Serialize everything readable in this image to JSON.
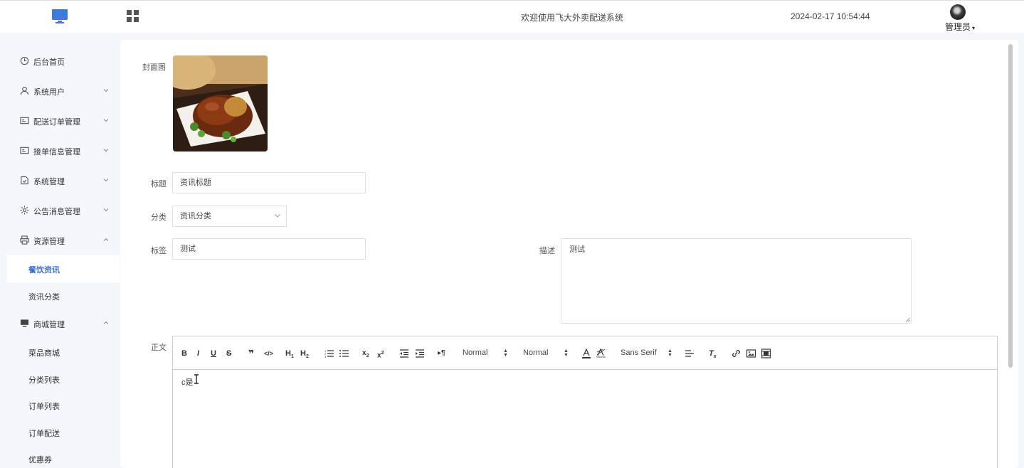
{
  "header": {
    "welcome": "欢迎使用飞大外卖配送系统",
    "datetime": "2024-02-17 10:54:44",
    "user_name": "管理员",
    "logo_icon": "monitor-icon",
    "apps_icon": "grid-icon"
  },
  "sidebar": {
    "items": [
      {
        "label": "后台首页",
        "icon": "clock-icon"
      },
      {
        "label": "系统用户",
        "icon": "user-icon"
      },
      {
        "label": "配送订单管理",
        "icon": "card-icon"
      },
      {
        "label": "接单信息管理",
        "icon": "card-icon"
      },
      {
        "label": "系统管理",
        "icon": "doc-check-icon"
      },
      {
        "label": "公告消息管理",
        "icon": "sun-icon"
      },
      {
        "label": "资源管理",
        "icon": "printer-icon"
      }
    ],
    "resource_sub": [
      "餐饮资讯",
      "资讯分类"
    ],
    "mall": {
      "label": "商城管理",
      "icon": "monitor-icon"
    },
    "mall_sub": [
      "菜品商城",
      "分类列表",
      "订单列表",
      "订单配送",
      "优惠券"
    ]
  },
  "form": {
    "cover_label": "封面图",
    "title_label": "标题",
    "title_value": "资讯标题",
    "category_label": "分类",
    "category_value": "资讯分类",
    "tag_label": "标签",
    "tag_value": "测试",
    "desc_label": "描述",
    "desc_value": "测试",
    "body_label": "正文"
  },
  "editor": {
    "header_select": "Normal",
    "size_select": "Normal",
    "font_select": "Sans Serif",
    "content": "c是"
  },
  "colors": {
    "accent": "#3b6fd6",
    "sidebar_bg": "#f4f7fc",
    "border": "#dcdfe6"
  }
}
